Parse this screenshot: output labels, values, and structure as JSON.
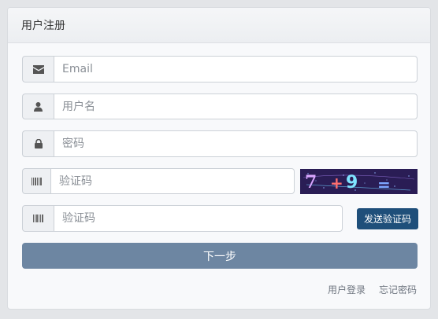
{
  "panel": {
    "title": "用户注册"
  },
  "form": {
    "email": {
      "placeholder": "Email",
      "icon": "envelope-icon"
    },
    "username": {
      "placeholder": "用户名",
      "icon": "user-icon"
    },
    "password": {
      "placeholder": "密码",
      "icon": "lock-icon"
    },
    "captcha": {
      "placeholder": "验证码",
      "icon": "barcode-icon",
      "image_text": "7+9="
    },
    "sms_code": {
      "placeholder": "验证码",
      "icon": "barcode-icon"
    },
    "send_code_label": "发送验证码",
    "next_label": "下一步"
  },
  "links": {
    "login": "用户登录",
    "forgot_password": "忘记密码"
  },
  "colors": {
    "primary": "#6d86a2",
    "send_button": "#1f4f7a",
    "captcha_bg": "#2a1d55"
  }
}
